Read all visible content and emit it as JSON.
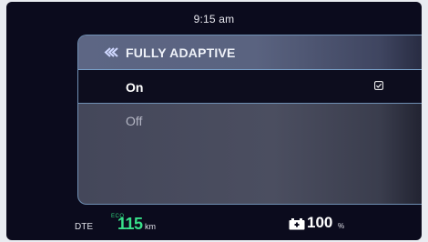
{
  "status": {
    "time": "9:15 am"
  },
  "panel": {
    "title": "FULLY ADAPTIVE",
    "back_icon": "double-chevron-left-icon",
    "options": [
      {
        "label": "On",
        "selected": true,
        "check_icon": "checkbox-checked-icon"
      },
      {
        "label": "Off",
        "selected": false
      }
    ]
  },
  "bottom_bar": {
    "dte_label": "DTE",
    "eco_label": "ECO",
    "range_value": "115",
    "range_unit": "km",
    "battery_icon": "battery-icon",
    "battery_value": "100",
    "battery_unit": "%"
  },
  "colors": {
    "background": "#0b0b1d",
    "panel": "#4b4e60",
    "accent_border": "#6f8fb3",
    "range_green": "#38e08a"
  }
}
